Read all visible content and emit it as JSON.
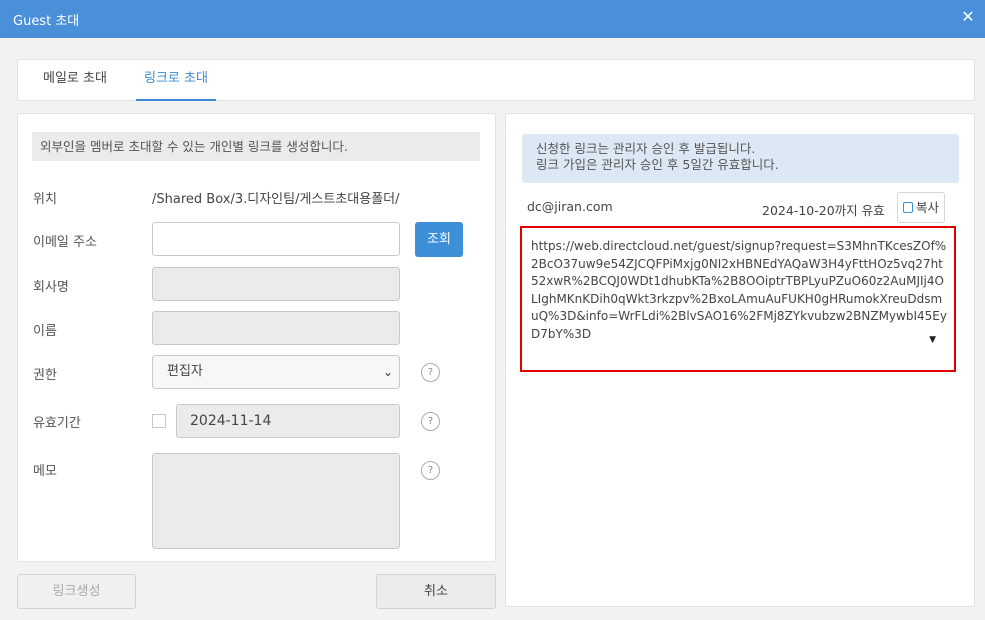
{
  "window": {
    "title": "Guest 초대",
    "close_label": "✕"
  },
  "tabs": [
    {
      "label": "메일로 초대",
      "active": false
    },
    {
      "label": "링크로 초대",
      "active": true
    }
  ],
  "form": {
    "info_text": "외부인을 멤버로 초대할 수 있는 개인별 링크를 생성합니다.",
    "location_label": "위치",
    "location_value": "/Shared Box/3.디자인팀/게스트초대용폴더/",
    "email_label": "이메일 주소",
    "email_value": "",
    "query_button": "조회",
    "company_label": "회사명",
    "company_value": "",
    "name_label": "이름",
    "name_value": "",
    "permission_label": "권한",
    "permission_value": "편집자",
    "expiry_label": "유효기간",
    "expiry_checked": false,
    "expiry_date": "2024-11-14",
    "memo_label": "메모",
    "memo_value": "",
    "help_glyph": "?"
  },
  "buttons": {
    "generate_link": "링크생성",
    "cancel": "취소"
  },
  "link_panel": {
    "notice_line1": "신청한 링크는 관리자 승인 후 발급됩니다.",
    "notice_line2": "링크 가입은 관리자 승인 후 5일간 유효합니다.",
    "email": "dc@jiran.com",
    "valid_until": "2024-10-20까지 유효",
    "copy_label": "복사",
    "link_url": "https://web.directcloud.net/guest/signup?request=S3MhnTKcesZOf%2BcO37uw9e54ZJCQFPiMxjg0NI2xHBNEdYAQaW3H4yFttHOz5vq27ht52xwR%2BCQJ0WDt1dhubKTa%2B8OOiptrTBPLyuPZuO60z2AuMJIj4OLIghMKnKDih0qWkt3rkzpv%2BxoLAmuAuFUKH0gHRumokXreuDdsmuQ%3D&info=WrFLdi%2BlvSAO16%2FMj8ZYkvubzw2BNZMywbI45EyD7bY%3D"
  },
  "colors": {
    "titlebar": "#4a90d9",
    "accent": "#3d8fd8",
    "highlight_border": "#e00000",
    "notice_bg": "#dce9f5"
  },
  "icons": {
    "close": "close-icon",
    "help": "help-icon",
    "copy": "copy-icon",
    "dropdown": "chevron-down-icon"
  }
}
